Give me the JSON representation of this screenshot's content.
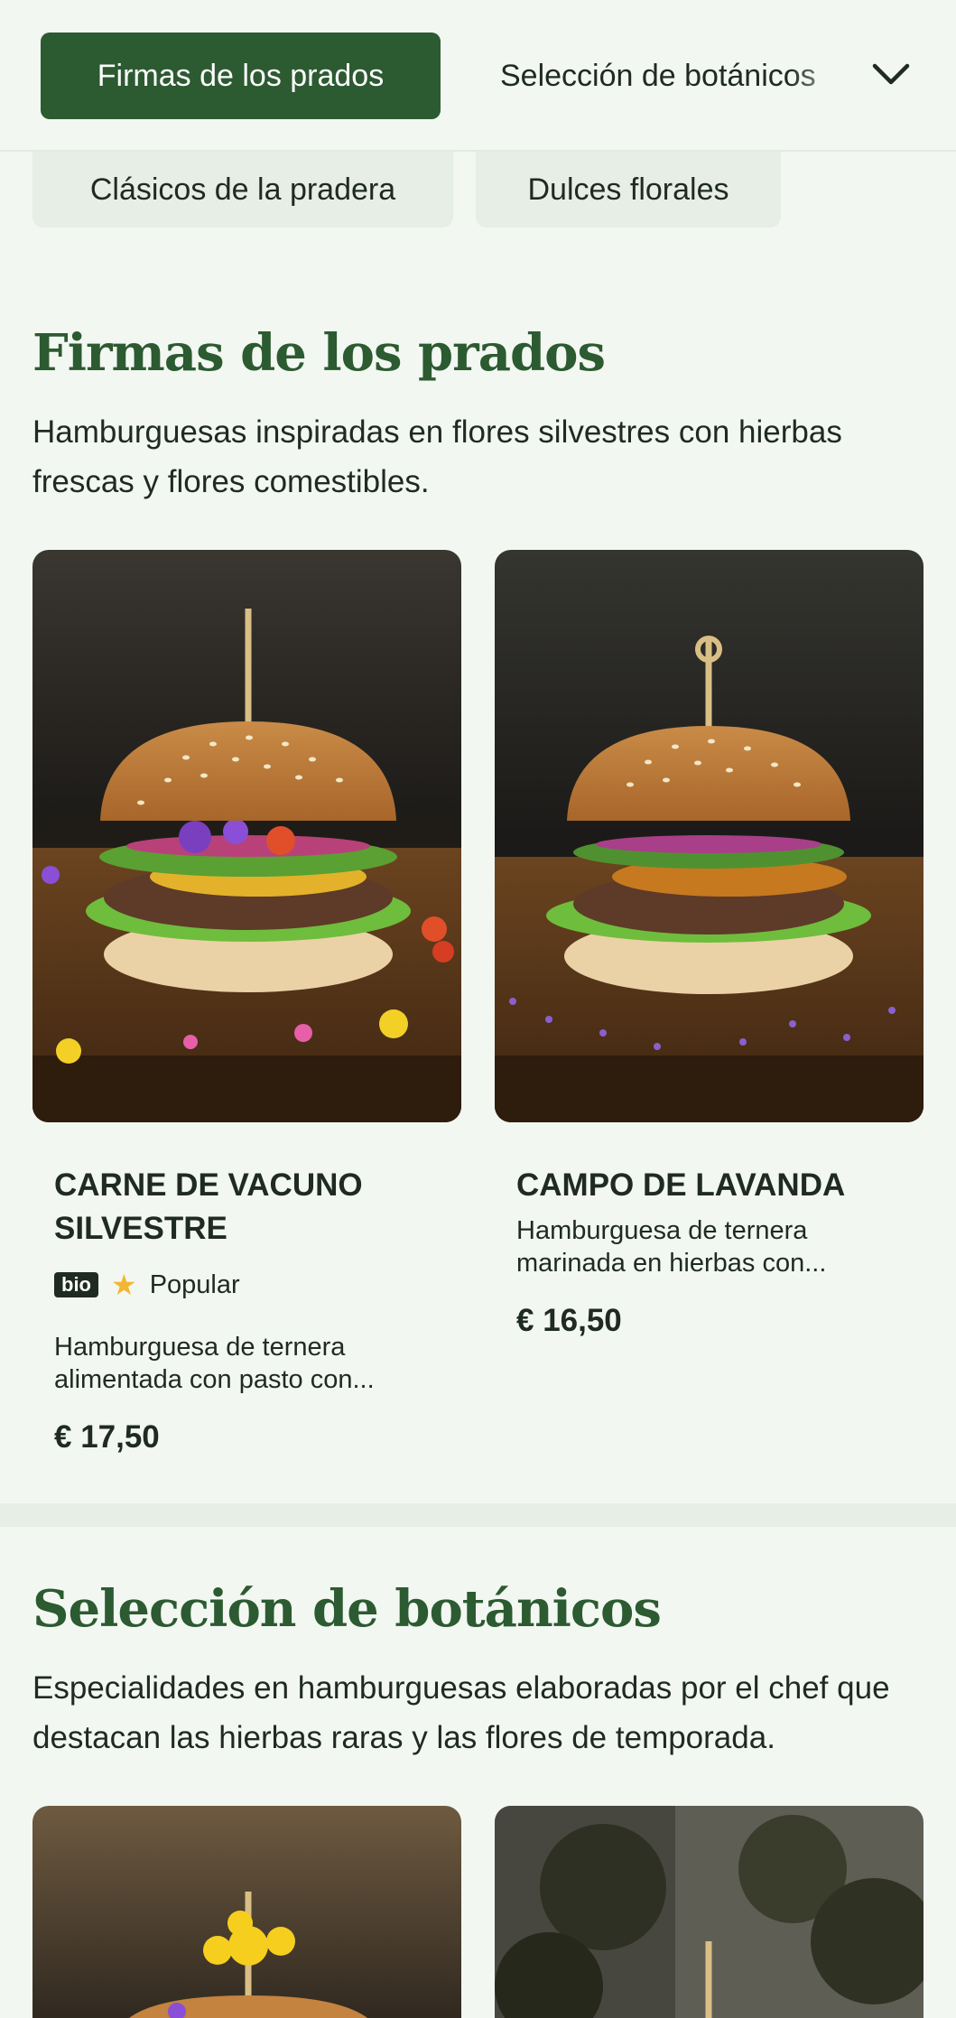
{
  "nav": {
    "active_tab": "Firmas de los prados",
    "next_tab": "Selección de botánicos",
    "subtabs": [
      "Clásicos de la pradera",
      "Dulces florales"
    ]
  },
  "sections": [
    {
      "title": "Firmas de los prados",
      "description": "Hamburguesas inspiradas en flores silvestres con hierbas frescas y flores comestibles.",
      "products": [
        {
          "name": "CARNE DE VACUNO SILVESTRE",
          "badge": "bio",
          "tag": "Popular",
          "description": "Hamburguesa de ternera alimentada con pasto con...",
          "price": "€ 17,50"
        },
        {
          "name": "CAMPO DE LAVANDA",
          "description": "Hamburguesa de ternera marinada en hierbas con...",
          "price": "€ 16,50"
        }
      ]
    },
    {
      "title": "Selección de botánicos",
      "description": "Especialidades en hamburguesas elaboradas por el chef que destacan las hierbas raras y las flores de temporada."
    }
  ],
  "colors": {
    "accent": "#2c5a31",
    "background": "#f2f7f1",
    "chip": "#e6eee5",
    "text": "#1f2a22",
    "star": "#f2b632"
  },
  "icons": [
    "chevron-down-icon",
    "star-icon"
  ]
}
